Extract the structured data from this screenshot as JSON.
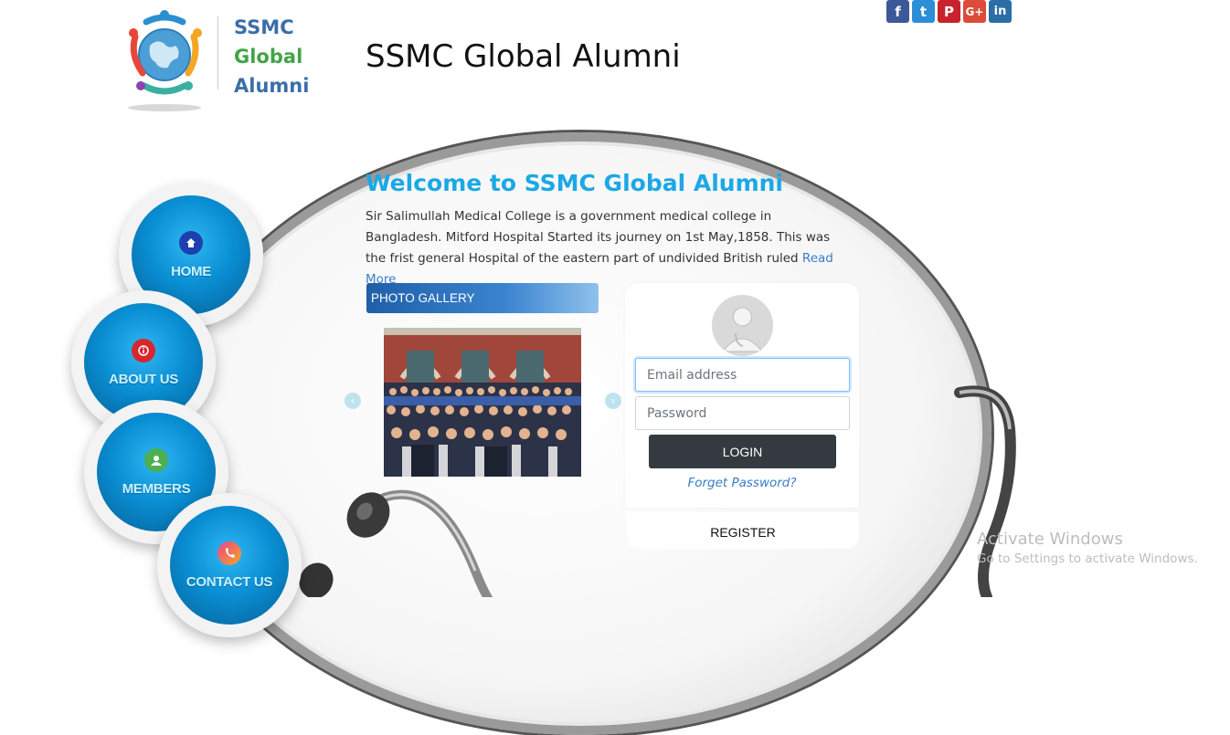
{
  "header": {
    "site_title": "SSMC Global Alumni",
    "logo": {
      "line1": "SSMC",
      "line2": "Global",
      "line3": "Alumni"
    }
  },
  "socials": [
    {
      "name": "facebook-icon",
      "glyph": "f",
      "color": "#3b5998"
    },
    {
      "name": "twitter-icon",
      "glyph": "t",
      "color": "#2b8ed6"
    },
    {
      "name": "pinterest-icon",
      "glyph": "P",
      "color": "#c8232c"
    },
    {
      "name": "googleplus-icon",
      "glyph": "G+",
      "color": "#dd4b39"
    },
    {
      "name": "linkedin-icon",
      "glyph": "in",
      "color": "#2b6ea5"
    }
  ],
  "nav": {
    "home": "HOME",
    "about": "ABOUT US",
    "members": "MEMBERS",
    "contact": "CONTACT US"
  },
  "welcome": {
    "title": "Welcome to SSMC Global Alumni",
    "text": "Sir Salimullah Medical College is a government medical college in Bangladesh. Mitford Hospital Started its journey on 1st May,1858. This was the frist general Hospital of the eastern part of undivided British ruled ",
    "read_more": "Read More"
  },
  "gallery": {
    "title": "PHOTO GALLERY"
  },
  "login": {
    "email_placeholder": "Email address",
    "password_placeholder": "Password",
    "login_label": "LOGIN",
    "forget_label": "Forget Password?",
    "register_label": "REGISTER"
  },
  "watermark": {
    "line1": "Activate Windows",
    "line2": "Go to Settings to activate Windows."
  }
}
